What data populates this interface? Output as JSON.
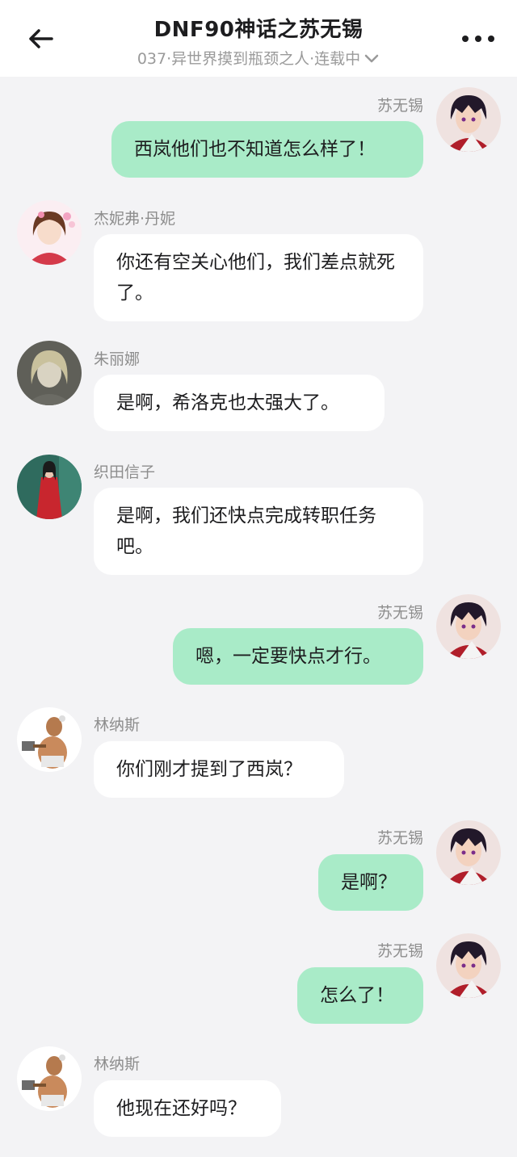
{
  "header": {
    "title": "DNF90神话之苏无锡",
    "subtitle": "037·异世界摸到瓶颈之人·连载中"
  },
  "messages": [
    {
      "sender": "苏无锡",
      "text": "西岚他们也不知道怎么样了！",
      "side": "right",
      "avatar": "avatar-suwuxi"
    },
    {
      "sender": "杰妮弗·丹妮",
      "text": "你还有空关心他们，我们差点就死了。",
      "side": "left",
      "avatar": "avatar-jennifer"
    },
    {
      "sender": "朱丽娜",
      "text": "是啊，希洛克也太强大了。",
      "side": "left",
      "avatar": "avatar-juliana"
    },
    {
      "sender": "织田信子",
      "text": "是啊，我们还快点完成转职任务吧。",
      "side": "left",
      "avatar": "avatar-oda"
    },
    {
      "sender": "苏无锡",
      "text": "嗯，一定要快点才行。",
      "side": "right",
      "avatar": "avatar-suwuxi"
    },
    {
      "sender": "林纳斯",
      "text": "你们刚才提到了西岚？",
      "side": "left",
      "avatar": "avatar-linus"
    },
    {
      "sender": "苏无锡",
      "text": "是啊？",
      "side": "right",
      "avatar": "avatar-suwuxi"
    },
    {
      "sender": "苏无锡",
      "text": "怎么了！",
      "side": "right",
      "avatar": "avatar-suwuxi"
    },
    {
      "sender": "林纳斯",
      "text": "他现在还好吗？",
      "side": "left",
      "avatar": "avatar-linus"
    }
  ],
  "icons": [
    "back-arrow-icon",
    "chevron-down-icon",
    "more-icon"
  ],
  "colors": {
    "my_bubble": "#a9ebc8",
    "other_bubble": "#ffffff",
    "background": "#f3f3f5"
  }
}
